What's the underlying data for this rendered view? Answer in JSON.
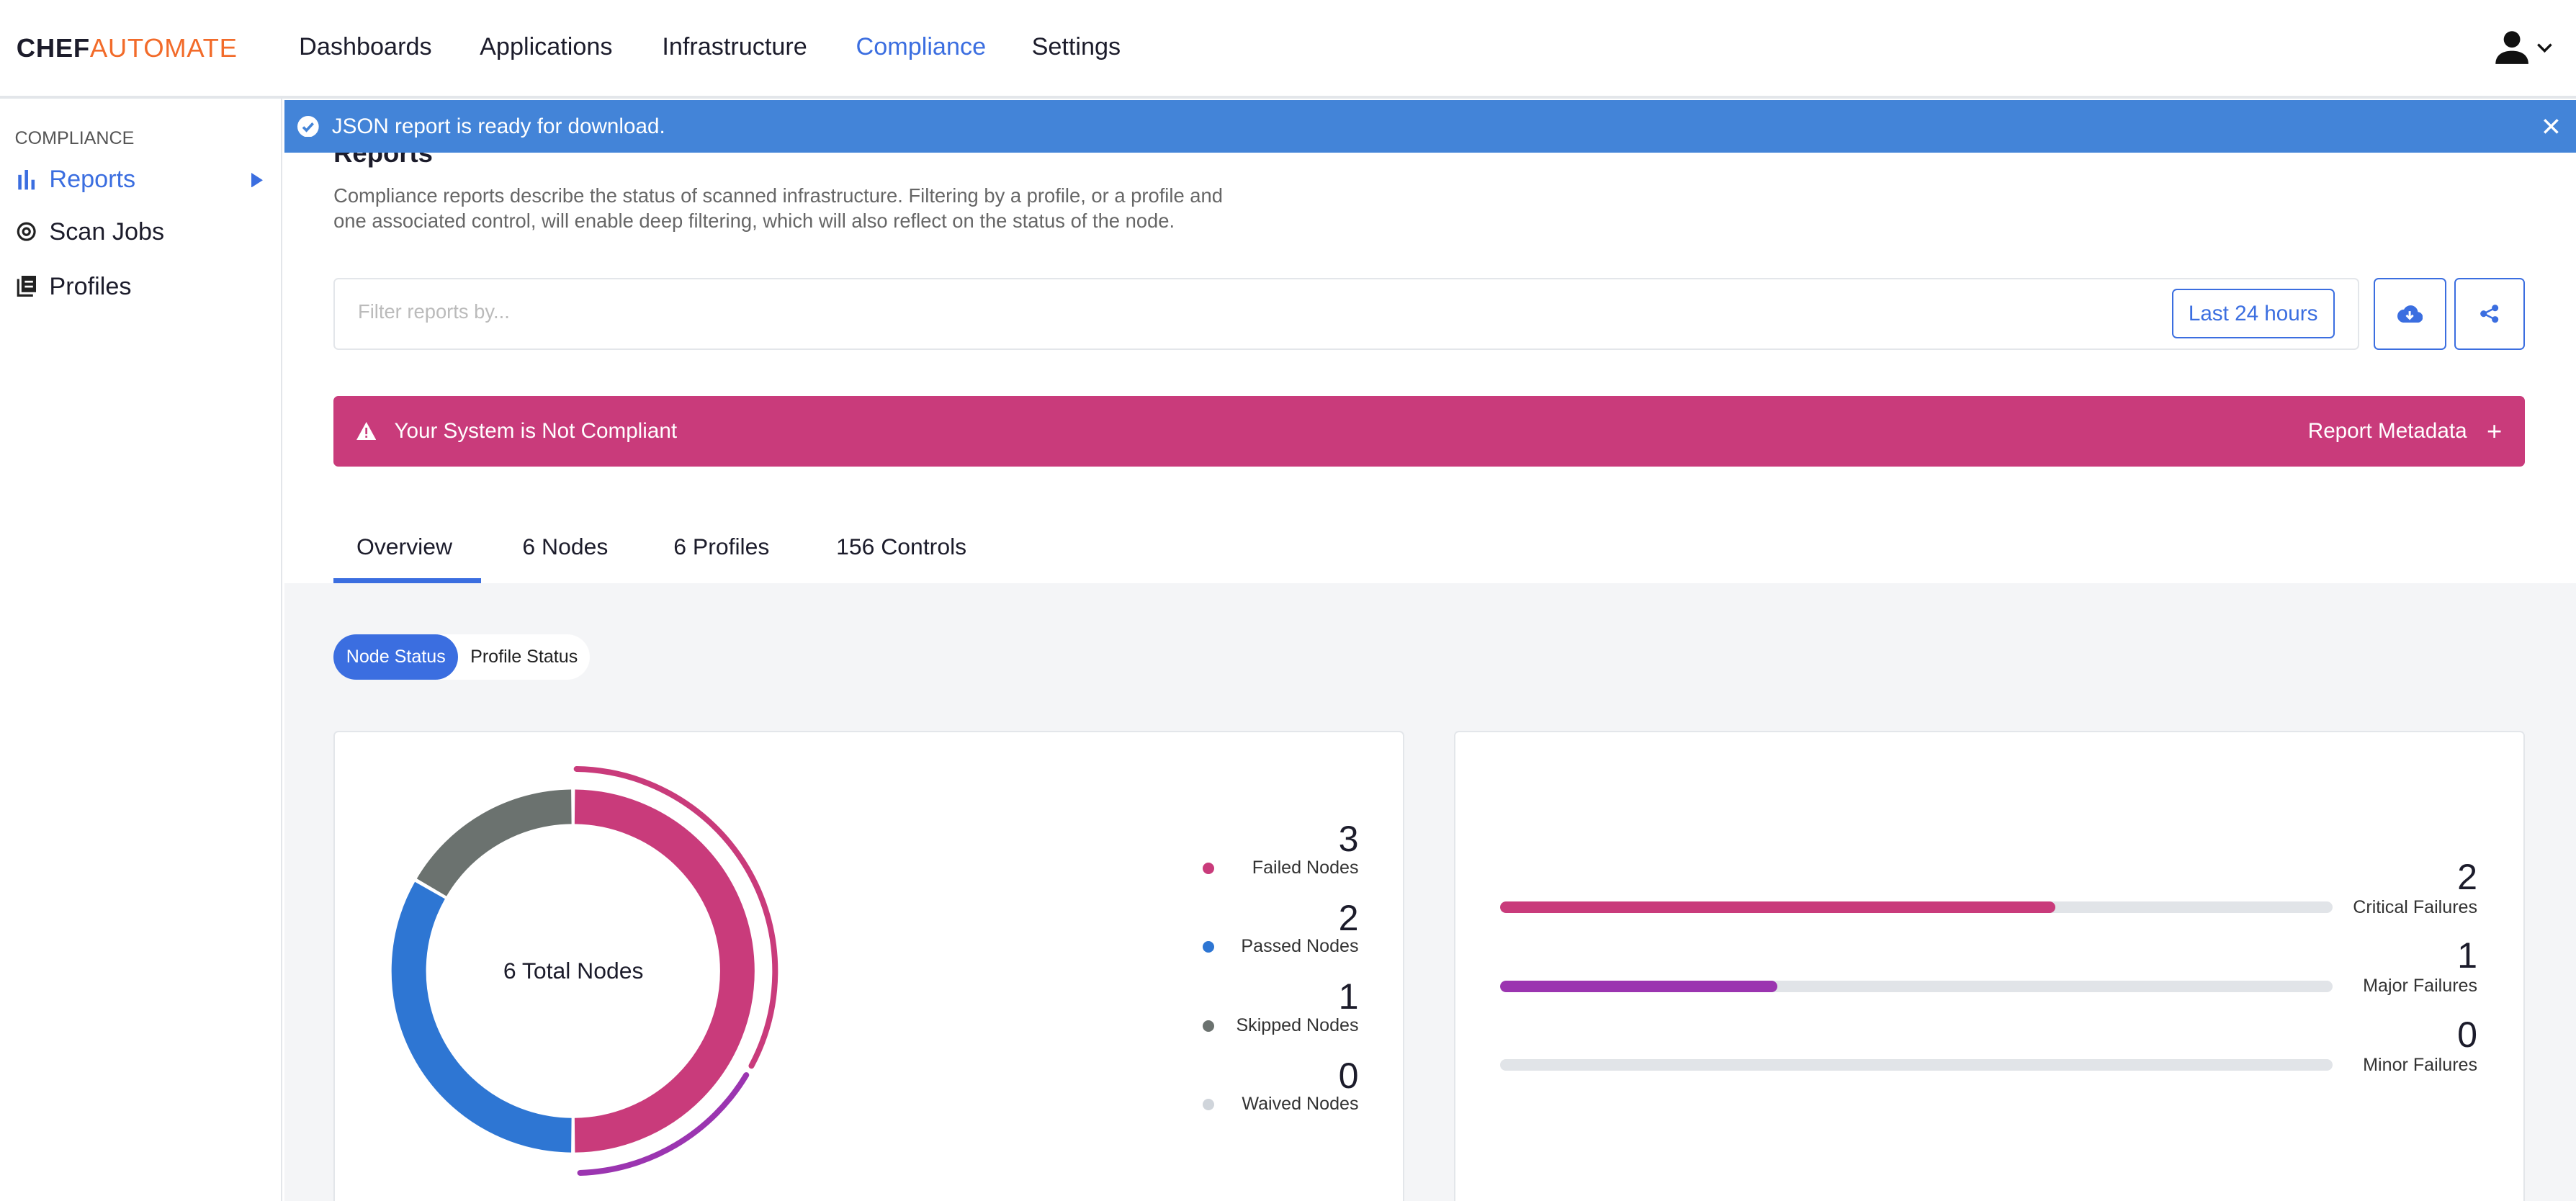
{
  "header": {
    "logo_primary": "CHEF",
    "logo_secondary": "AUTOMATE",
    "nav": [
      {
        "label": "Dashboards"
      },
      {
        "label": "Applications"
      },
      {
        "label": "Infrastructure"
      },
      {
        "label": "Compliance",
        "active": true
      },
      {
        "label": "Settings"
      }
    ],
    "user_icon": "user-icon"
  },
  "sidebar": {
    "heading": "COMPLIANCE",
    "items": [
      {
        "label": "Reports",
        "icon": "bar-chart-icon",
        "active": true
      },
      {
        "label": "Scan Jobs",
        "icon": "radar-icon"
      },
      {
        "label": "Profiles",
        "icon": "book-icon"
      }
    ]
  },
  "toast": {
    "message": "JSON report is ready for download."
  },
  "page": {
    "title": "Reports",
    "description": "Compliance reports describe the status of scanned infrastructure. Filtering by a profile, or a profile and one associated control, will enable deep filtering, which will also reflect on the status of the node."
  },
  "filter": {
    "placeholder": "Filter reports by...",
    "value": "",
    "date_range": "Last 24 hours"
  },
  "banner": {
    "status": "Your System is Not Compliant",
    "metadata_label": "Report Metadata",
    "color": "#c93b7b"
  },
  "tabs": [
    {
      "label": "Overview",
      "active": true
    },
    {
      "label": "6 Nodes"
    },
    {
      "label": "6 Profiles"
    },
    {
      "label": "156 Controls"
    }
  ],
  "toggle": {
    "options": [
      "Node Status",
      "Profile Status"
    ],
    "selected": "Node Status"
  },
  "node_status": {
    "center_label": "6 Total Nodes",
    "legend": [
      {
        "count": "3",
        "label": "Failed Nodes",
        "value": 3,
        "color": "#c93b7b"
      },
      {
        "count": "2",
        "label": "Passed Nodes",
        "value": 2,
        "color": "#2e76d3"
      },
      {
        "count": "1",
        "label": "Skipped Nodes",
        "value": 1,
        "color": "#6b726f"
      },
      {
        "count": "0",
        "label": "Waived Nodes",
        "value": 0,
        "color": "#d0d5db"
      }
    ]
  },
  "failures": [
    {
      "count": "2",
      "label": "Critical Failures",
      "value": 2,
      "color": "#c93b7b"
    },
    {
      "count": "1",
      "label": "Major Failures",
      "value": 1,
      "color": "#9b35b0"
    },
    {
      "count": "0",
      "label": "Minor Failures",
      "value": 0,
      "color": "#9b35b0"
    }
  ]
}
